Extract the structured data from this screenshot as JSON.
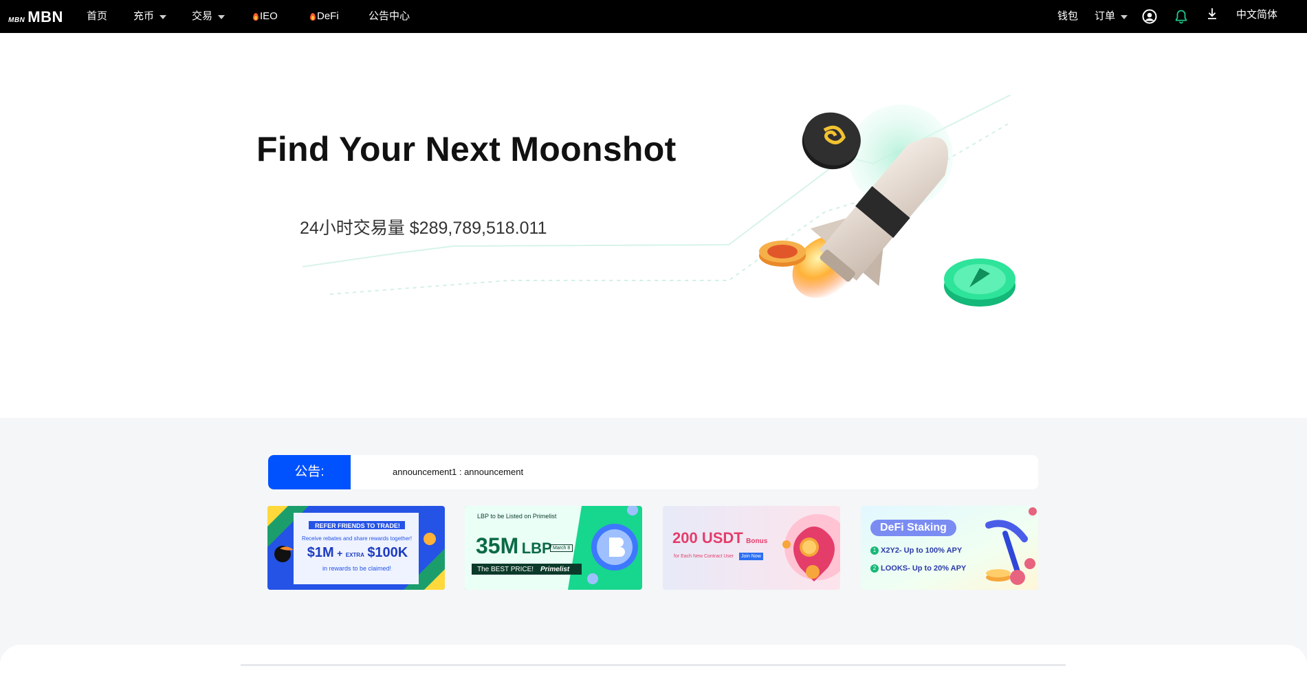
{
  "header": {
    "logo_small": "MBN",
    "logo_text": "MBN",
    "nav": {
      "home": "首页",
      "deposit": "充币",
      "trade": "交易",
      "ieo": "IEO",
      "defi": "DeFi",
      "announcements": "公告中心"
    },
    "wallet": "钱包",
    "orders": "订单",
    "language": "中文简体",
    "icons": {
      "account": "user-circle-icon",
      "notifications": "bell-icon",
      "download": "download-icon"
    },
    "colors": {
      "background": "#000000",
      "bell": "#1ec98b",
      "fire": "#ff5a2a"
    }
  },
  "hero": {
    "title": "Find Your Next Moonshot",
    "volume_label": "24小时交易量",
    "volume_value": "$289,789,518.011"
  },
  "announcement": {
    "label": "公告:",
    "text": "announcement1 : announcement",
    "accent": "#0052ff"
  },
  "banners": [
    {
      "line1": "REFER FRIENDS TO TRADE!",
      "line2": "Receive rebates and share rewards together!",
      "amount": "$1M",
      "plus": "+",
      "extra": "EXTRA",
      "extra_amount": "$100K",
      "line3": "in rewards to be claimed!"
    },
    {
      "line1": "LBP to be Listed on Primelist",
      "amount": "35M",
      "token": "LBP",
      "date": "March 8",
      "tagline": "The  BEST PRICE!",
      "brand": "Primelist"
    },
    {
      "amount": "200 USDT",
      "bonus": "Bonus",
      "sub": "for Each New Contract User",
      "cta": "Join Now"
    },
    {
      "title": "DeFi Staking",
      "item1": "X2Y2- Up to 100% APY",
      "item2": "LOOKS- Up to 20% APY",
      "bullet1": "1",
      "bullet2": "2"
    }
  ]
}
